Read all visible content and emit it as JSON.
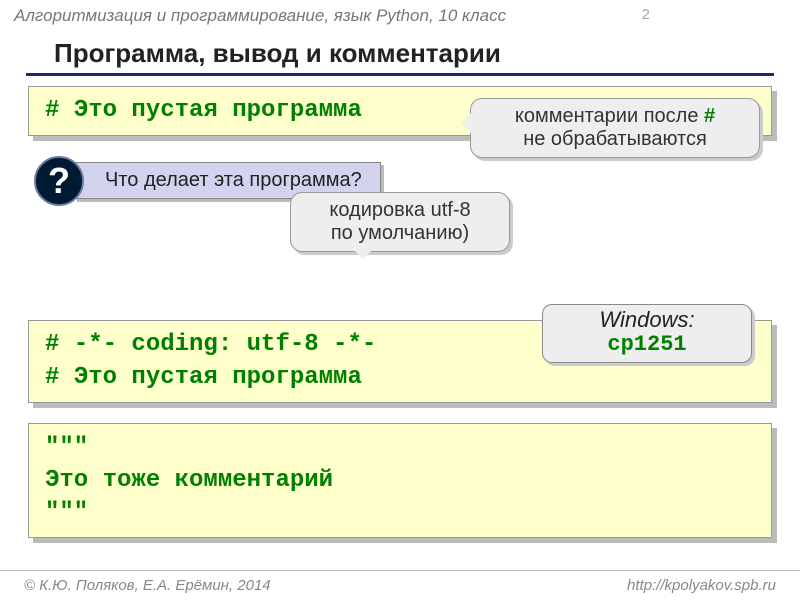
{
  "header": {
    "course": "Алгоритмизация и программирование, язык Python, 10 класс",
    "page": "2"
  },
  "title": "Программа, вывод и комментарии",
  "code1": "# Это пустая программа",
  "bubble1": {
    "prefix": "комментарии после ",
    "hash": "#",
    "suffix": " не обрабатываются"
  },
  "question": {
    "mark": "?",
    "text": "Что делает эта программа?"
  },
  "bubble2": {
    "line1": "кодировка utf-8",
    "line2": "по умолчанию)"
  },
  "code2": {
    "l1": "# -*- coding: utf-8 -*-",
    "l2": "# Это пустая программа"
  },
  "bubble3": {
    "win": "Windows:",
    "cp": "cp1251"
  },
  "code3": {
    "l1": "\"\"\"",
    "l2": "Это тоже комментарий",
    "l3": "\"\"\""
  },
  "footer": {
    "left": "© К.Ю. Поляков, Е.А. Ерёмин, 2014",
    "right": "http://kpolyakov.spb.ru"
  }
}
